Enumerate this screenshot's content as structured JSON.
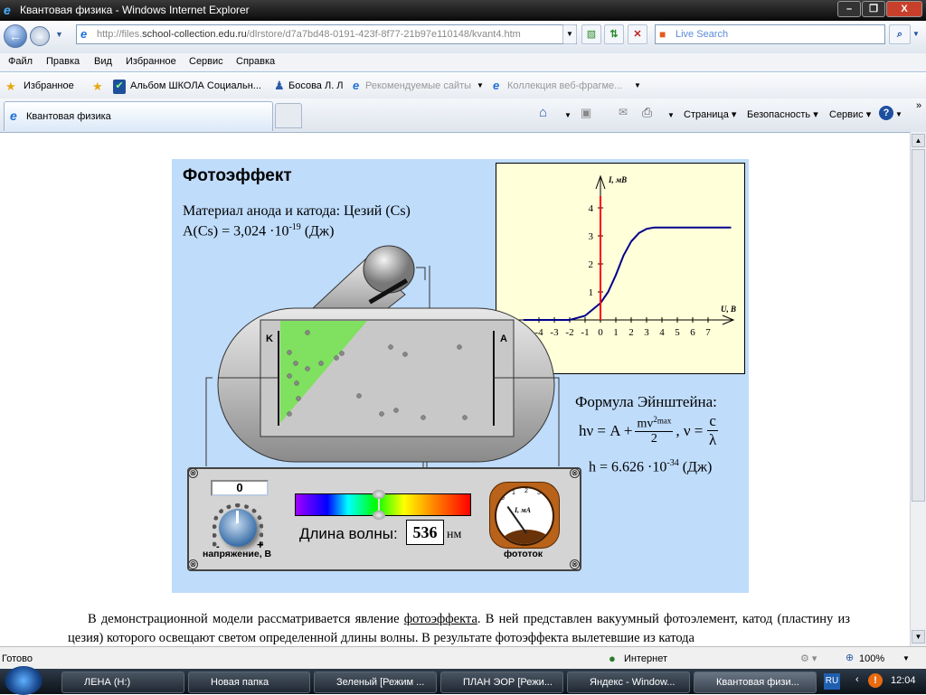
{
  "window": {
    "title": "Квантовая физика - Windows Internet Explorer",
    "min": "–",
    "max": "❐",
    "close": "X"
  },
  "address": {
    "prefix": "http://files.",
    "host": "school-collection.edu.ru",
    "path": "/dlrstore/d7a7bd48-0191-423f-8f77-21b97e110148/kvant4.htm"
  },
  "search": {
    "placeholder": "Live Search"
  },
  "menu": [
    "Файл",
    "Правка",
    "Вид",
    "Избранное",
    "Сервис",
    "Справка"
  ],
  "favorites": {
    "label": "Избранное",
    "items": [
      "Альбом ШКОЛА  Социальн...",
      "Босова Л. Л",
      "Рекомендуемые сайты",
      "Коллекция веб-фрагме..."
    ]
  },
  "tab": {
    "label": "Квантовая физика"
  },
  "commands": [
    "Страница",
    "Безопасность",
    "Сервис"
  ],
  "applet": {
    "title": "Фотоэффект",
    "material": "Материал анода и катода: Цезий (Cs)",
    "work_fn_pre": "A(Cs) = 3,024 ·10",
    "work_fn_exp": "-19",
    "work_fn_post": " (Дж)",
    "cathode": "K",
    "anode": "A",
    "formula_title": "Формула Эйнштейна:",
    "formula_lhs": "hν = A +",
    "formula_num": "mv",
    "formula_num_sup": "2",
    "formula_num_sub": "max",
    "formula_den": "2",
    "formula_mid": ", ν =",
    "formula_c": "c",
    "formula_lambda": "λ",
    "planck_pre": "h = 6.626 ·10",
    "planck_exp": "-34",
    "planck_post": " (Дж)",
    "voltage_value": "0",
    "voltage_label": "напряжение, В",
    "minus": "-",
    "plus": "+",
    "wavelength_label": "Длина волны:",
    "wavelength_value": "536",
    "wavelength_unit": "нм",
    "meter_label": "фототок",
    "meter_unit": "I, мА",
    "meter_ticks": [
      "0",
      "1",
      "2",
      "3",
      "4"
    ],
    "meter_reading_mA": 0.6,
    "slider_wavelength_fraction": 0.47
  },
  "chart_data": {
    "type": "line",
    "xlabel": "U, В",
    "ylabel": "I, мВ",
    "xticks": [
      "-4",
      "-3",
      "-2",
      "-1",
      "0",
      "1",
      "2",
      "3",
      "4",
      "5",
      "6",
      "7"
    ],
    "yticks": [
      "1",
      "2",
      "3",
      "4"
    ],
    "xlim": [
      -5,
      8.5
    ],
    "ylim": [
      0,
      4.5
    ],
    "series": [
      {
        "x": [
          -5,
          -2,
          -1,
          0,
          0.5,
          1,
          1.5,
          2,
          2.5,
          3,
          3.5,
          4,
          8.5
        ],
        "y": [
          0,
          0,
          0.15,
          0.6,
          1.0,
          1.6,
          2.3,
          2.8,
          3.1,
          3.25,
          3.3,
          3.3,
          3.3
        ],
        "color": "#00008b"
      }
    ],
    "marker_line": {
      "x": 0,
      "color": "#ff0000"
    }
  },
  "paragraph": {
    "p1": "В демонстрационной модели рассматривается явление ",
    "link": "фотоэффекта",
    "p2": ". В ней представлен вакуумный фотоэлемент, катод (пластину из цезия) которого освещают светом определенной длины волны. В результате фотоэффекта вылетевшие из катода"
  },
  "status": {
    "text": "Готово",
    "zone": "Интернет",
    "zoom": "100%"
  },
  "taskbar": {
    "items": [
      "ЛЕНА (H:)",
      "Новая папка",
      "Зеленый [Режим ...",
      "ПЛАН ЭОР [Режи...",
      "Яндекс - Window...",
      "Квантовая физи..."
    ],
    "lang": "RU",
    "time": "12:04"
  }
}
